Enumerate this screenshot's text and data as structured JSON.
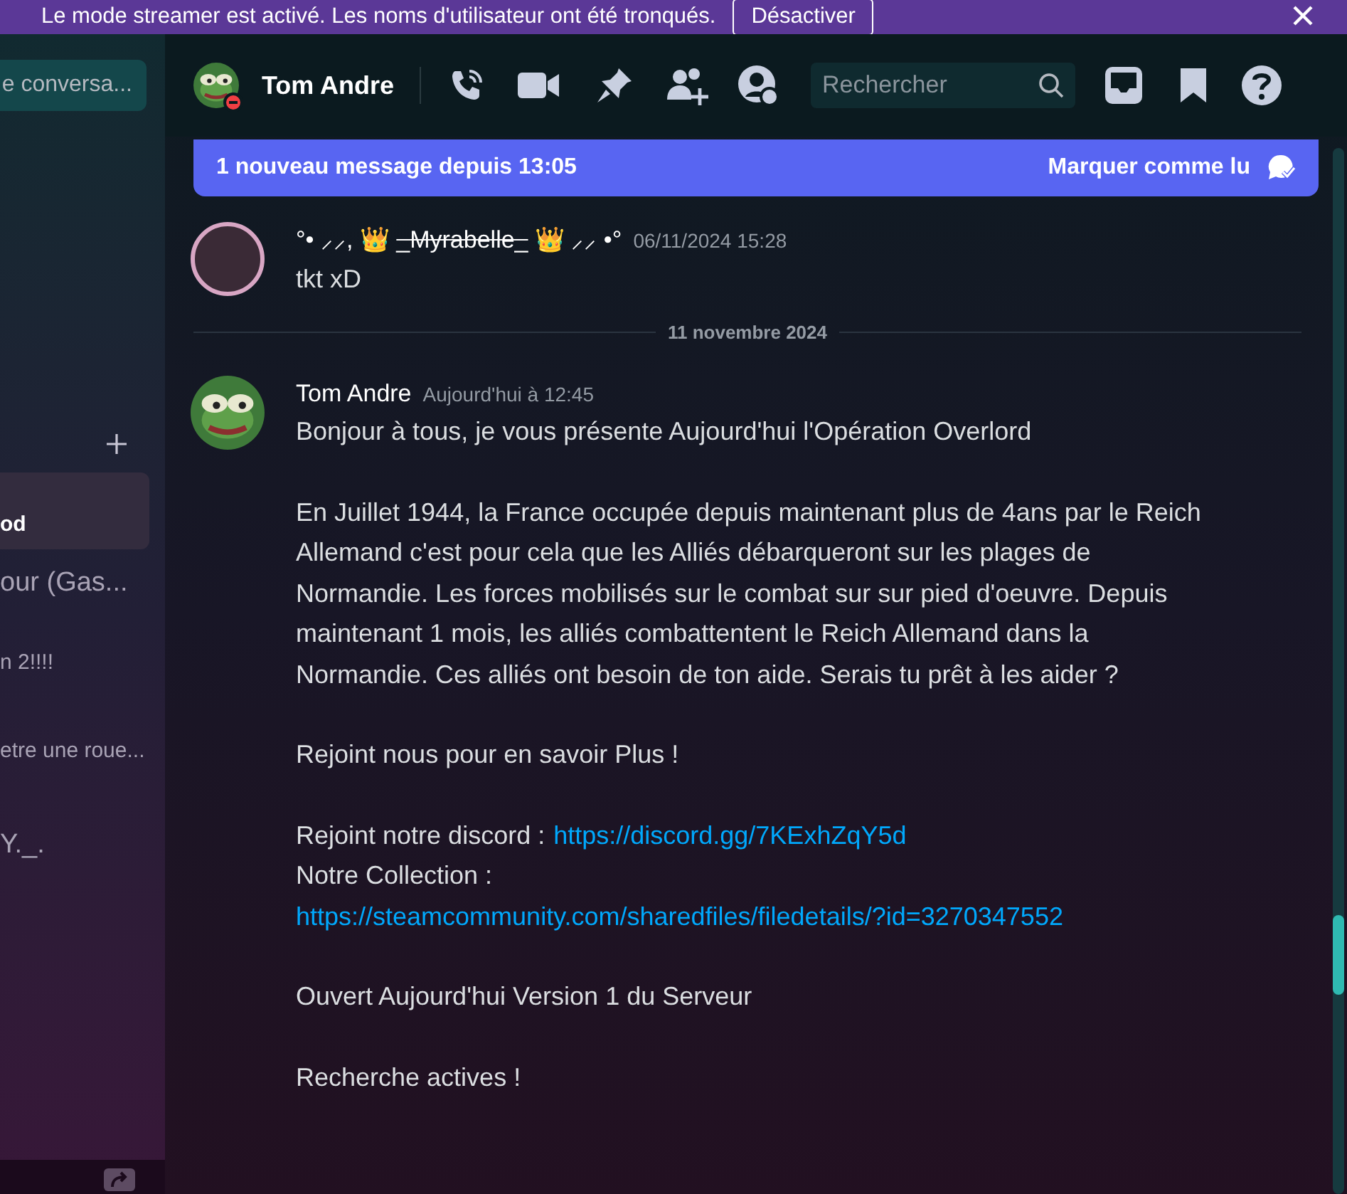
{
  "streamer_banner": {
    "text": "Le mode streamer est activé. Les noms d'utilisateur ont été tronqués.",
    "button": "Désactiver"
  },
  "sidebar": {
    "search_placeholder": "e conversa...",
    "items": [
      {
        "label": "od",
        "selected": true
      },
      {
        "label": "our (Gas...",
        "selected": false
      },
      {
        "label": "n 2!!!!",
        "selected": false
      },
      {
        "label": "etre une roue...",
        "selected": false
      },
      {
        "label": "Y._.",
        "selected": false
      }
    ]
  },
  "header": {
    "name": "Tom Andre",
    "do_not_disturb": true,
    "search_placeholder": "Rechercher"
  },
  "new_messages_bar": {
    "text": "1 nouveau message depuis 13:05",
    "action": "Marquer comme lu"
  },
  "messages": [
    {
      "author_prefix": "°• ⸝⸝, 👑",
      "author": "_Myrabelle_",
      "author_suffix": "👑 ⸝⸝ •°",
      "strikethrough": true,
      "photo_avatar": true,
      "timestamp": "06/11/2024 15:28",
      "body": [
        {
          "kind": "text",
          "text": "tkt xD"
        }
      ]
    },
    {
      "kind": "divider",
      "label": "11 novembre 2024"
    },
    {
      "author": "Tom Andre",
      "strikethrough": false,
      "photo_avatar": false,
      "timestamp": "Aujourd'hui à 12:45",
      "body": [
        {
          "kind": "text",
          "text": "Bonjour à tous, je vous présente Aujourd'hui l'Opération Overlord"
        },
        {
          "kind": "text",
          "text": "En Juillet 1944, la France occupée depuis maintenant plus de 4ans par le Reich Allemand c'est pour cela que les Alliés débarqueront sur les plages de Normandie. Les forces mobilisés sur le combat sur sur pied d'oeuvre. Depuis maintenant 1 mois, les alliés combattentent le Reich Allemand dans la Normandie. Ces alliés ont besoin de ton aide. Serais tu prêt à les aider ?"
        },
        {
          "kind": "text",
          "text": "Rejoint nous pour en savoir Plus !"
        },
        {
          "kind": "links",
          "lines": [
            {
              "label": "Rejoint notre discord :",
              "url": "https://discord.gg/7KExhZqY5d"
            },
            {
              "label": "Notre Collection :",
              "url": "https://steamcommunity.com/sharedfiles/filedetails/?id=3270347552"
            }
          ]
        },
        {
          "kind": "text",
          "text": "Ouvert Aujourd'hui Version 1 du Serveur"
        },
        {
          "kind": "text",
          "text": "Recherche actives !"
        }
      ]
    }
  ]
}
